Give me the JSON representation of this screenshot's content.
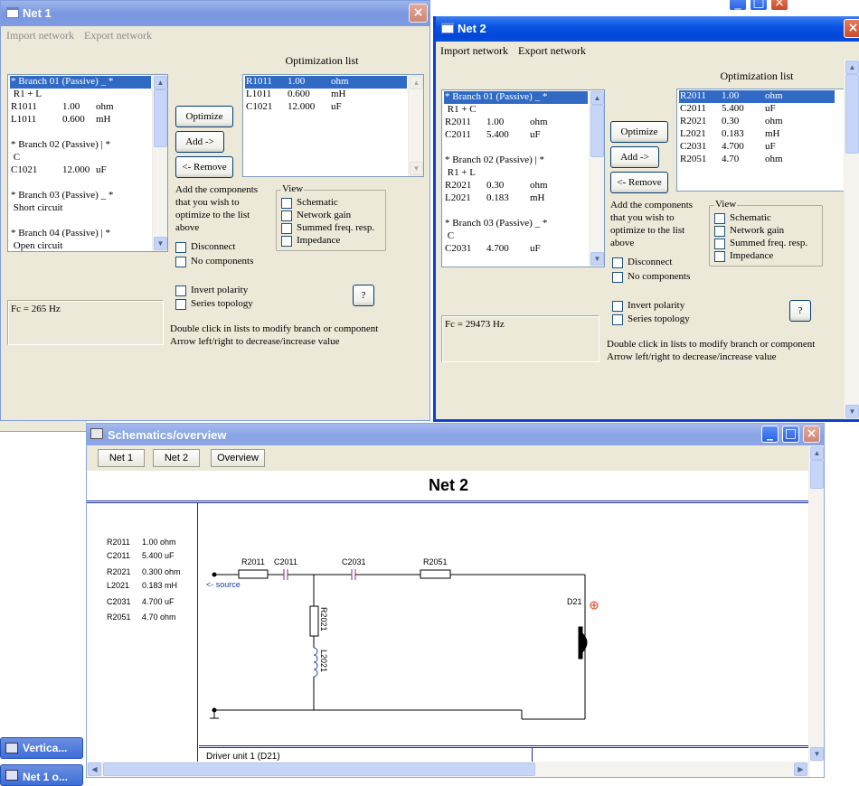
{
  "top_buttons": {
    "min": "_",
    "max": "□",
    "close": "×"
  },
  "net1": {
    "title": "Net 1",
    "menu": {
      "import": "Import network",
      "export": "Export network"
    },
    "branches_list": [
      {
        "a": "* Branch 01 (Passive) _ *",
        "b": "",
        "c": "",
        "selected": true
      },
      {
        "a": " R1 + L",
        "b": "",
        "c": ""
      },
      {
        "a": "R1011",
        "b": "1.00",
        "c": "ohm"
      },
      {
        "a": "L1011",
        "b": "0.600",
        "c": "mH"
      },
      {
        "a": "",
        "b": "",
        "c": ""
      },
      {
        "a": "* Branch 02 (Passive) | *",
        "b": "",
        "c": ""
      },
      {
        "a": " C",
        "b": "",
        "c": ""
      },
      {
        "a": "C1021",
        "b": "12.000",
        "c": "uF"
      },
      {
        "a": "",
        "b": "",
        "c": ""
      },
      {
        "a": "* Branch 03 (Passive) _ *",
        "b": "",
        "c": ""
      },
      {
        "a": " Short circuit",
        "b": "",
        "c": ""
      },
      {
        "a": "",
        "b": "",
        "c": ""
      },
      {
        "a": "* Branch 04 (Passive) | *",
        "b": "",
        "c": ""
      },
      {
        "a": " Open circuit",
        "b": "",
        "c": ""
      }
    ],
    "opt_label": "Optimization list",
    "opt_list": [
      {
        "a": "R1011",
        "b": "1.00",
        "c": "ohm",
        "selected": true
      },
      {
        "a": "L1011",
        "b": "0.600",
        "c": "mH"
      },
      {
        "a": "C1021",
        "b": "12.000",
        "c": "uF"
      }
    ],
    "optimize_btn": "Optimize",
    "add_btn": "Add ->",
    "remove_btn": "<- Remove",
    "hint_lines": [
      "Add the components",
      "that you wish to",
      "optimize to the list",
      "above"
    ],
    "view_label": "View",
    "view_items": [
      "Schematic",
      "Network gain",
      "Summed freq. resp.",
      "Impedance"
    ],
    "disconnect": "Disconnect",
    "no_components": "No components",
    "invert": "Invert polarity",
    "series": "Series topology",
    "help_btn": "?",
    "fc": "Fc = 265 Hz",
    "footer1": "Double click in lists to modify branch or component",
    "footer2": "Arrow left/right to decrease/increase value"
  },
  "net2": {
    "title": "Net 2",
    "menu": {
      "import": "Import network",
      "export": "Export network"
    },
    "branches_list": [
      {
        "a": "* Branch 01 (Passive) _ *",
        "b": "",
        "c": "",
        "selected": true
      },
      {
        "a": " R1 + C",
        "b": "",
        "c": ""
      },
      {
        "a": "R2011",
        "b": "1.00",
        "c": "ohm"
      },
      {
        "a": "C2011",
        "b": "5.400",
        "c": "uF"
      },
      {
        "a": "",
        "b": "",
        "c": ""
      },
      {
        "a": "* Branch 02 (Passive) | *",
        "b": "",
        "c": ""
      },
      {
        "a": " R1 + L",
        "b": "",
        "c": ""
      },
      {
        "a": "R2021",
        "b": "0.30",
        "c": "ohm"
      },
      {
        "a": "L2021",
        "b": "0.183",
        "c": "mH"
      },
      {
        "a": "",
        "b": "",
        "c": ""
      },
      {
        "a": "* Branch 03 (Passive) _ *",
        "b": "",
        "c": ""
      },
      {
        "a": " C",
        "b": "",
        "c": ""
      },
      {
        "a": "C2031",
        "b": "4.700",
        "c": "uF"
      }
    ],
    "opt_label": "Optimization list",
    "opt_list": [
      {
        "a": "R2011",
        "b": "1.00",
        "c": "ohm",
        "selected": true
      },
      {
        "a": "C2011",
        "b": "5.400",
        "c": "uF"
      },
      {
        "a": "R2021",
        "b": "0.30",
        "c": "ohm"
      },
      {
        "a": "L2021",
        "b": "0.183",
        "c": "mH"
      },
      {
        "a": "C2031",
        "b": "4.700",
        "c": "uF"
      },
      {
        "a": "R2051",
        "b": "4.70",
        "c": "ohm"
      }
    ],
    "optimize_btn": "Optimize",
    "add_btn": "Add ->",
    "remove_btn": "<- Remove",
    "hint_lines": [
      "Add the components",
      "that you wish to",
      "optimize to the list",
      "above"
    ],
    "view_label": "View",
    "view_items": [
      "Schematic",
      "Network gain",
      "Summed freq. resp.",
      "Impedance"
    ],
    "disconnect": "Disconnect",
    "no_components": "No components",
    "invert": "Invert polarity",
    "series": "Series topology",
    "help_btn": "?",
    "fc": "Fc = 29473 Hz",
    "footer1": "Double click in lists to modify branch or component",
    "footer2": "Arrow left/right to decrease/increase value"
  },
  "schematics": {
    "title": "Schematics/overview",
    "tabs": [
      "Net 1",
      "Net 2",
      "Overview"
    ],
    "heading": "Net 2",
    "components": [
      {
        "name": "R2011",
        "value": "1.00 ohm"
      },
      {
        "name": "C2011",
        "value": "5.400 uF"
      },
      {
        "name": "R2021",
        "value": "0.300 ohm"
      },
      {
        "name": "L2021",
        "value": "0.183 mH"
      },
      {
        "name": "C2031",
        "value": "4.700 uF"
      },
      {
        "name": "R2051",
        "value": "4.70 ohm"
      }
    ],
    "labels": {
      "r2011": "R2011",
      "c2011": "C2011",
      "c2031": "C2031",
      "r2051": "R2051",
      "r2021": "R2021",
      "l2021": "L2021",
      "d21": "D21",
      "source": "<- source"
    },
    "driver": "Driver unit 1 (D21)"
  },
  "taskbar": {
    "item1": "Vertica...",
    "item2": "Net 1 o..."
  }
}
